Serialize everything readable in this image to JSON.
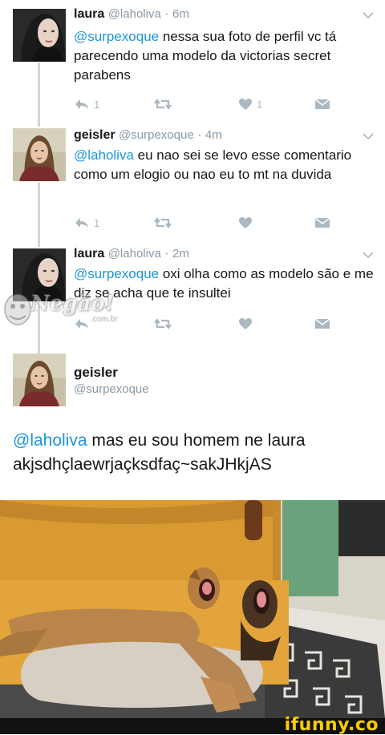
{
  "tweets": [
    {
      "name": "laura",
      "handle": "@laholiva",
      "time": "6m",
      "mention": "@surpexoque",
      "text": " nessa sua foto de perfil vc tá parecendo uma modelo da victorias secret parabens",
      "reply_count": "1",
      "like_count": "1",
      "liked": true
    },
    {
      "name": "geisler",
      "handle": "@surpexoque",
      "time": "4m",
      "mention": "@laholiva",
      "text": " eu nao sei se levo esse comentario como um elogio ou nao eu to mt na duvida",
      "reply_count": "1",
      "like_count": "",
      "liked": false
    },
    {
      "name": "laura",
      "handle": "@laholiva",
      "time": "2m",
      "mention": "@surpexoque",
      "text": " oxi olha como as modelo são e me diz se acha que te insultei",
      "reply_count": "",
      "like_count": "",
      "liked": false
    }
  ],
  "composer": {
    "name": "geisler",
    "handle": "@surpexoque",
    "reply_mention": "@laholiva",
    "reply_text": " mas eu sou homem ne laura akjsdhçlaewrjaçksdfaç~sakJHkjAS"
  },
  "watermark": {
    "main": "Negão!",
    "sub": ".com.br"
  },
  "footer": {
    "brand": "ifunny.co"
  },
  "colors": {
    "accent": "#1b95e0",
    "action_icon": "#aab8c2",
    "brand_yellow": "#ffcc00"
  }
}
